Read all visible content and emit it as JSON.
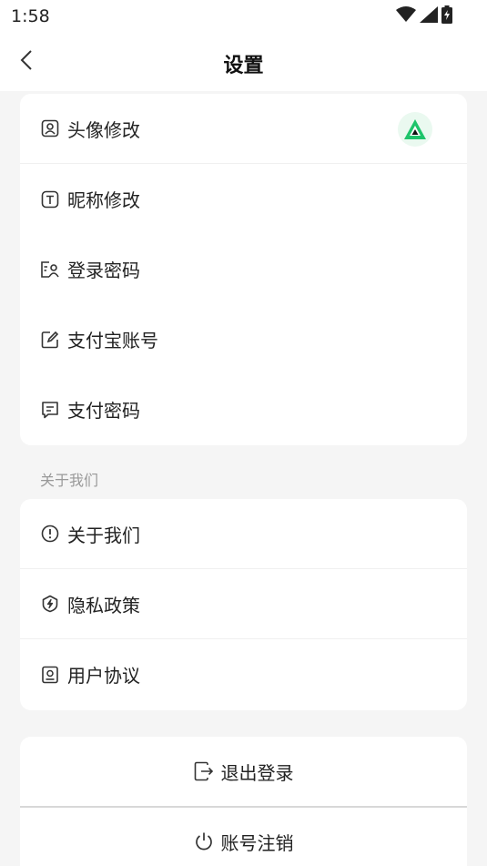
{
  "status_bar": {
    "time": "1:58"
  },
  "header": {
    "title": "设置"
  },
  "account_section": {
    "items": [
      {
        "label": "头像修改",
        "icon": "user-square-icon"
      },
      {
        "label": "昵称修改",
        "icon": "text-t-icon"
      },
      {
        "label": "登录密码",
        "icon": "id-card-icon"
      },
      {
        "label": "支付宝账号",
        "icon": "edit-icon"
      },
      {
        "label": "支付密码",
        "icon": "receipt-icon"
      }
    ]
  },
  "about_section": {
    "header": "关于我们",
    "items": [
      {
        "label": "关于我们",
        "icon": "info-circle-icon"
      },
      {
        "label": "隐私政策",
        "icon": "shield-bolt-icon"
      },
      {
        "label": "用户协议",
        "icon": "contract-icon"
      }
    ]
  },
  "actions": {
    "logout_label": "退出登录",
    "delete_account_label": "账号注销"
  },
  "colors": {
    "avatar_accent": "#1ec46b",
    "background": "#f5f5f5",
    "card": "#ffffff",
    "muted_text": "#999999"
  }
}
